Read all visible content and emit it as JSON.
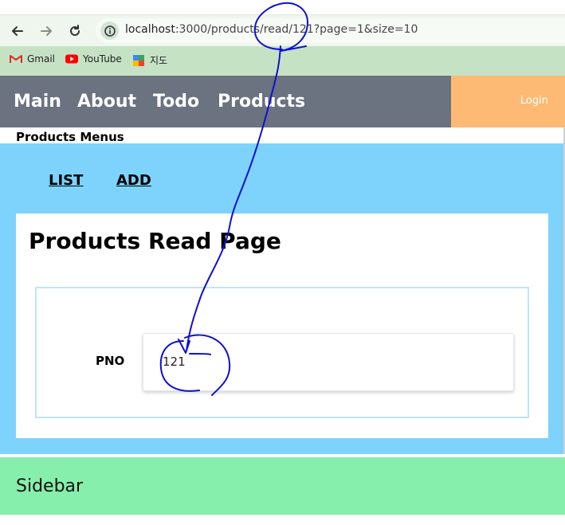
{
  "browser": {
    "url_host": "localhost",
    "url_rest": ":3000/products/read/121?page=1&size=10",
    "bookmarks": [
      {
        "label": "Gmail",
        "icon": "gmail-icon"
      },
      {
        "label": "YouTube",
        "icon": "youtube-icon"
      },
      {
        "label": "지도",
        "icon": "maps-icon"
      }
    ]
  },
  "nav": {
    "items": [
      "Main",
      "About",
      "Todo",
      "Products"
    ],
    "login": "Login"
  },
  "products_menu": {
    "title": "Products Menus",
    "links": [
      "LIST",
      "ADD"
    ]
  },
  "read_page": {
    "title": "Products Read Page",
    "pno_label": "PNO",
    "pno_value": "121"
  },
  "sidebar": {
    "label": "Sidebar"
  },
  "colors": {
    "nav_bg": "#6b7280",
    "login_bg": "#fdba74",
    "panel_bg": "#7dd3fc",
    "sidebar_bg": "#86efac",
    "bookmarks_bg": "#c5e2c5",
    "ink": "#1010d0"
  }
}
